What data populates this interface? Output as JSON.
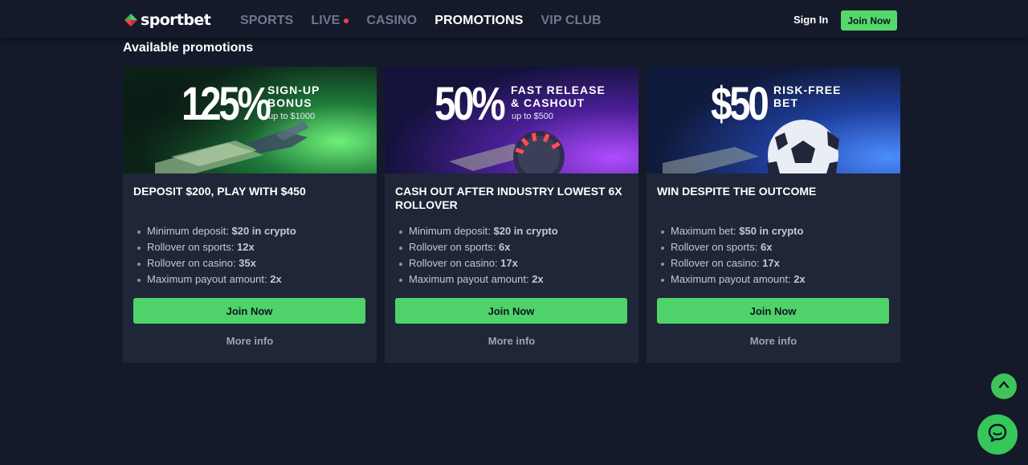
{
  "header": {
    "brand": "sportbet",
    "nav": [
      {
        "label": "SPORTS",
        "active": false
      },
      {
        "label": "LIVE",
        "active": false,
        "live_dot": true
      },
      {
        "label": "CASINO",
        "active": false
      },
      {
        "label": "PROMOTIONS",
        "active": true
      },
      {
        "label": "VIP CLUB",
        "active": false
      }
    ],
    "sign_in": "Sign In",
    "join_now": "Join Now"
  },
  "section_title": "Available promotions",
  "promotions": [
    {
      "banner": {
        "big": "125%",
        "line1": "SIGN-UP",
        "line2": "BONUS",
        "sub": "up to $1000",
        "theme": "green"
      },
      "title": "DEPOSIT $200, PLAY WITH $450",
      "features": [
        {
          "label": "Minimum deposit: ",
          "value": "$20 in crypto"
        },
        {
          "label": "Rollover on sports: ",
          "value": "12x"
        },
        {
          "label": "Rollover on casino: ",
          "value": "35x"
        },
        {
          "label": "Maximum payout amount: ",
          "value": "2x"
        }
      ],
      "join": "Join Now",
      "more": "More info"
    },
    {
      "banner": {
        "big": "50%",
        "line1": "FAST RELEASE",
        "line2": "& CASHOUT",
        "sub": "up to $500",
        "theme": "purple"
      },
      "title": "CASH OUT AFTER INDUSTRY LOWEST 6X ROLLOVER",
      "features": [
        {
          "label": "Minimum deposit: ",
          "value": "$20 in crypto"
        },
        {
          "label": "Rollover on sports: ",
          "value": "6x"
        },
        {
          "label": "Rollover on casino: ",
          "value": "17x"
        },
        {
          "label": "Maximum payout amount: ",
          "value": "2x"
        }
      ],
      "join": "Join Now",
      "more": "More info"
    },
    {
      "banner": {
        "big": "$50",
        "line1": "RISK-FREE",
        "line2": "BET",
        "sub": "",
        "theme": "blue"
      },
      "title": "WIN DESPITE THE OUTCOME",
      "features": [
        {
          "label": "Maximum bet: ",
          "value": "$50 in crypto"
        },
        {
          "label": "Rollover on sports: ",
          "value": "6x"
        },
        {
          "label": "Rollover on casino: ",
          "value": "17x"
        },
        {
          "label": "Maximum payout amount: ",
          "value": "2x"
        }
      ],
      "join": "Join Now",
      "more": "More info"
    }
  ],
  "colors": {
    "background": "#141a2a",
    "card": "#1f2637",
    "accent_green": "#4fd26a",
    "live_dot": "#ff3b4e",
    "nav_inactive": "#6f7790"
  },
  "icons": {
    "scroll_top": "chevron-up-icon",
    "chat": "chat-bubble-icon",
    "logo": "diamond-logo-icon"
  }
}
